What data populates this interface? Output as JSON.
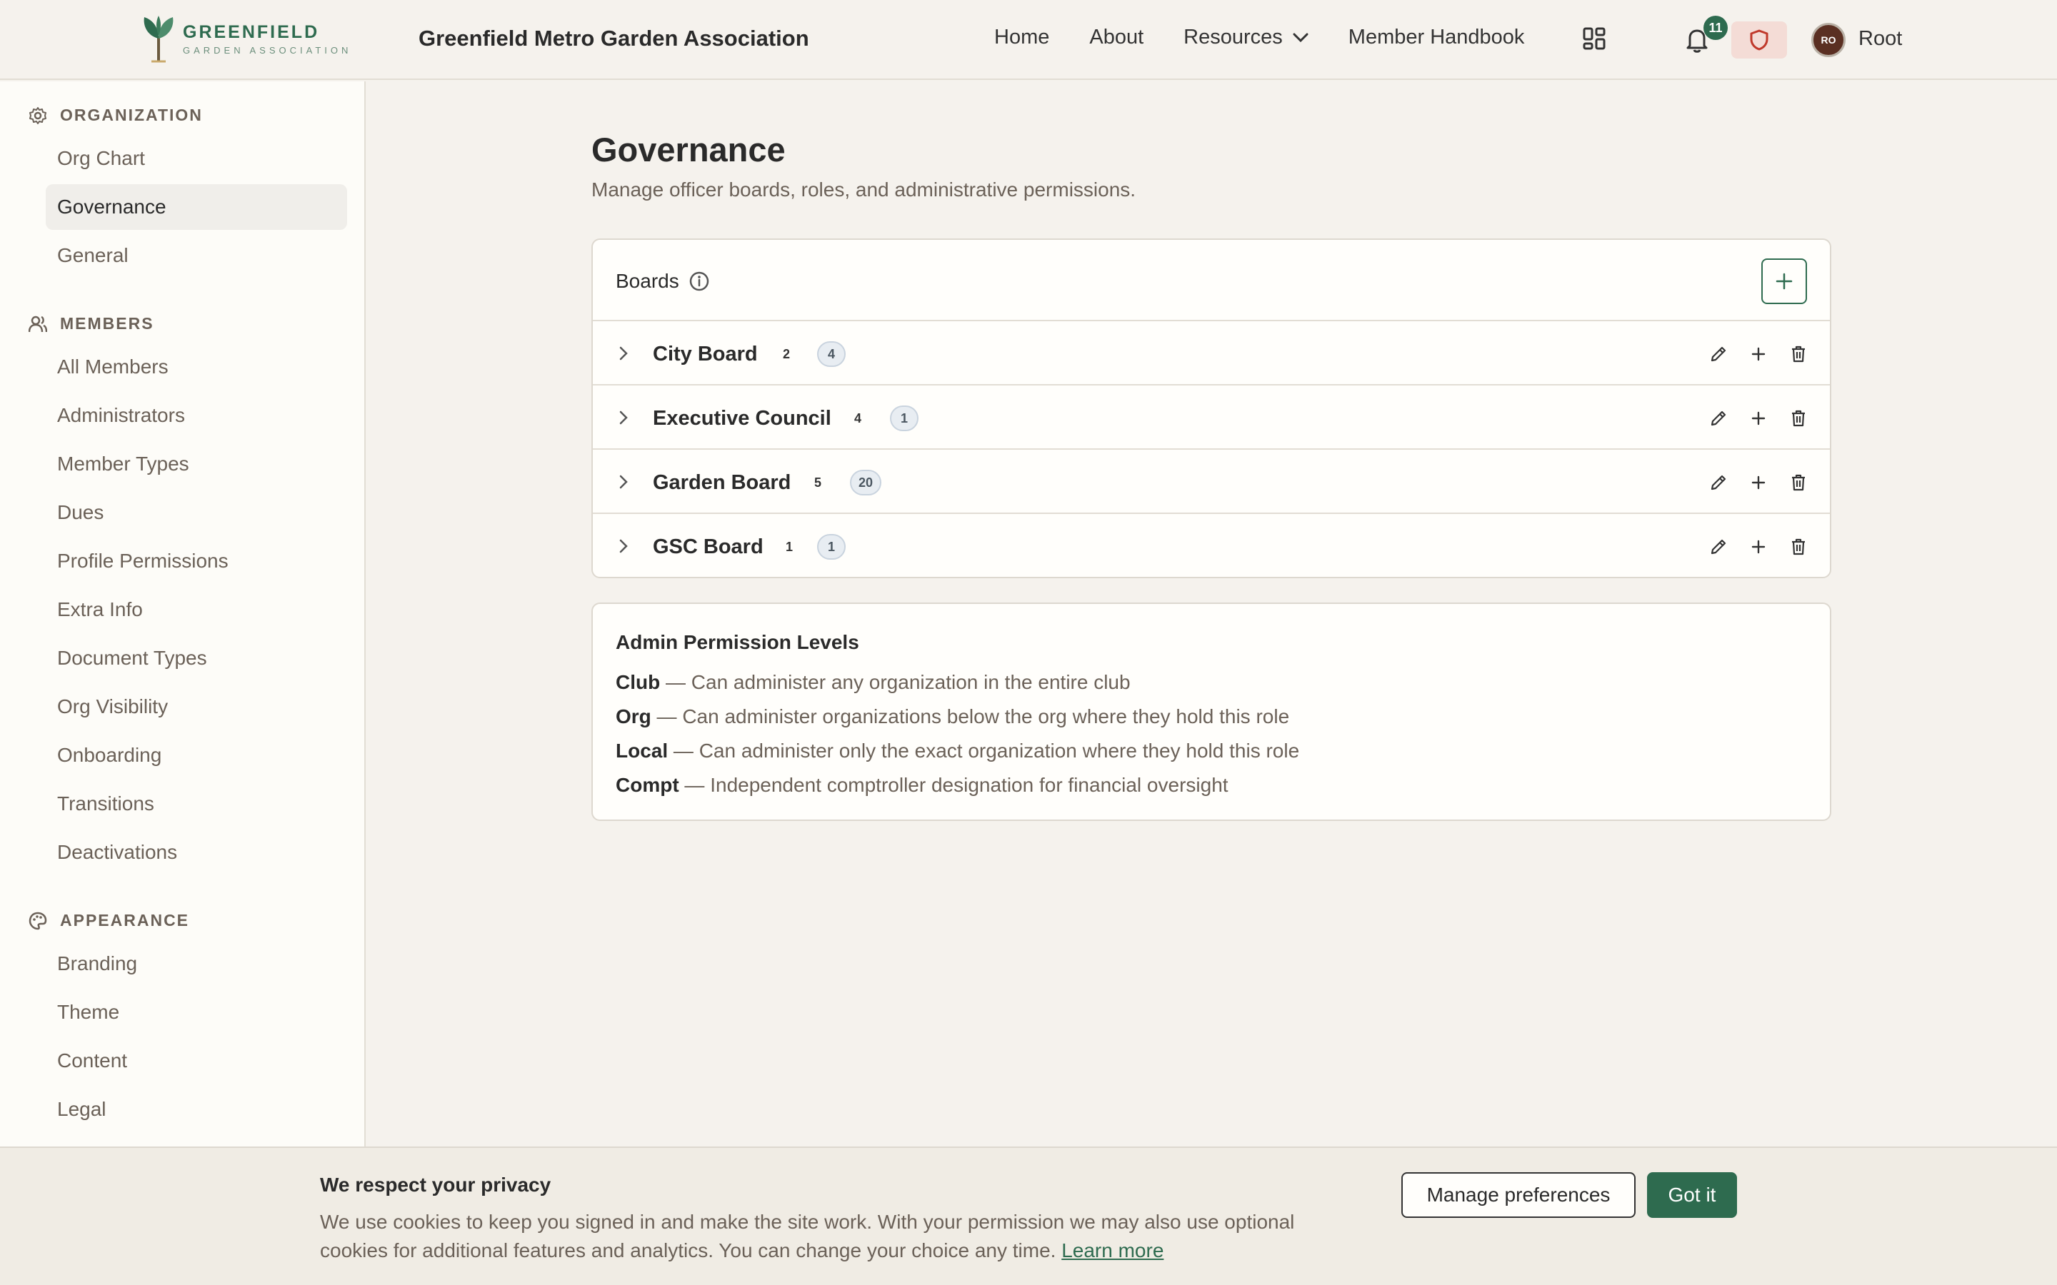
{
  "header": {
    "logo_main": "GREENFIELD",
    "logo_sub": "GARDEN ASSOCIATION",
    "site_title": "Greenfield Metro Garden Association",
    "nav": [
      {
        "label": "Home"
      },
      {
        "label": "About"
      },
      {
        "label": "Resources"
      },
      {
        "label": "Member Handbook"
      }
    ],
    "notification_count": "11",
    "avatar_initials": "RO",
    "user_name": "Root"
  },
  "sidebar": {
    "sections": [
      {
        "label": "ORGANIZATION",
        "icon": "gear-icon",
        "items": [
          "Org Chart",
          "Governance",
          "General"
        ]
      },
      {
        "label": "MEMBERS",
        "icon": "users-icon",
        "items": [
          "All Members",
          "Administrators",
          "Member Types",
          "Dues",
          "Profile Permissions",
          "Extra Info",
          "Document Types",
          "Org Visibility",
          "Onboarding",
          "Transitions",
          "Deactivations"
        ]
      },
      {
        "label": "APPEARANCE",
        "icon": "palette-icon",
        "items": [
          "Branding",
          "Theme",
          "Content",
          "Legal"
        ]
      }
    ],
    "active_item": "Governance"
  },
  "main": {
    "title": "Governance",
    "subtitle": "Manage officer boards, roles, and administrative permissions.",
    "boards": {
      "title": "Boards",
      "rows": [
        {
          "name": "City Board",
          "count": "2",
          "pill": "4"
        },
        {
          "name": "Executive Council",
          "count": "4",
          "pill": "1"
        },
        {
          "name": "Garden Board",
          "count": "5",
          "pill": "20"
        },
        {
          "name": "GSC Board",
          "count": "1",
          "pill": "1"
        }
      ]
    },
    "permissions": {
      "title": "Admin Permission Levels",
      "levels": [
        {
          "name": "Club",
          "desc": " — Can administer any organization in the entire club"
        },
        {
          "name": "Org",
          "desc": " — Can administer organizations below the org where they hold this role"
        },
        {
          "name": "Local",
          "desc": " — Can administer only the exact organization where they hold this role"
        },
        {
          "name": "Compt",
          "desc": " — Independent comptroller designation for financial oversight"
        }
      ]
    }
  },
  "cookie": {
    "title": "We respect your privacy",
    "body": "We use cookies to keep you signed in and make the site work. With your permission we may also use optional cookies for additional features and analytics. You can change your choice any time.",
    "link": "Learn more",
    "manage_label": "Manage preferences",
    "ok_label": "Got it"
  },
  "colors": {
    "brand_green": "#2e6b4f",
    "background": "#f5f2ed",
    "shield_bg": "#f4dcd6",
    "shield_red": "#c0392b"
  }
}
